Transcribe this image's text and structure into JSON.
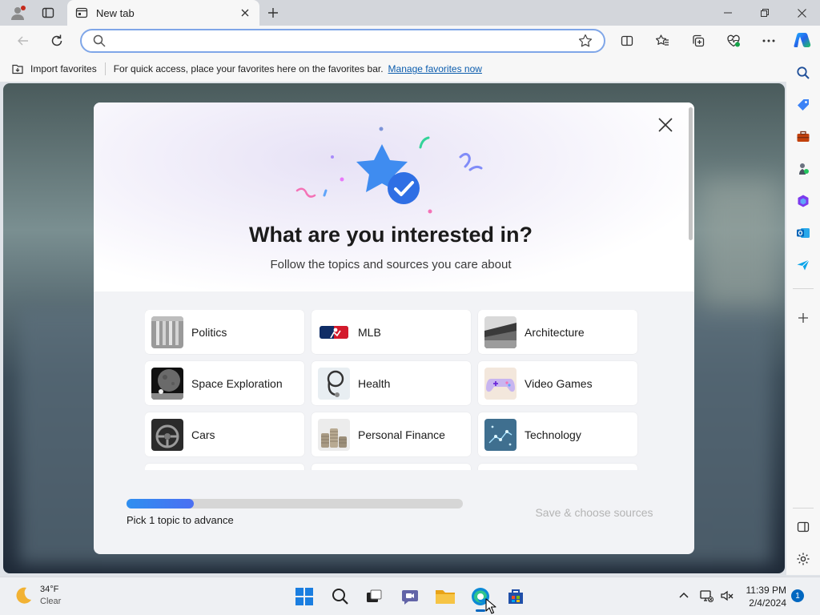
{
  "tab": {
    "title": "New tab"
  },
  "address_bar": {
    "value": "",
    "placeholder": ""
  },
  "favorites_bar": {
    "import_label": "Import favorites",
    "message": "For quick access, place your favorites here on the favorites bar.",
    "manage_link": "Manage favorites now"
  },
  "modal": {
    "title": "What are you interested in?",
    "subtitle": "Follow the topics and sources you care about",
    "topics": [
      {
        "label": "Politics",
        "thumb": "columns-icon"
      },
      {
        "label": "MLB",
        "thumb": "mlb-logo-icon"
      },
      {
        "label": "Architecture",
        "thumb": "building-icon"
      },
      {
        "label": "Space Exploration",
        "thumb": "astronaut-icon"
      },
      {
        "label": "Health",
        "thumb": "stethoscope-icon"
      },
      {
        "label": "Video Games",
        "thumb": "gamepad-icon"
      },
      {
        "label": "Cars",
        "thumb": "steering-wheel-icon"
      },
      {
        "label": "Personal Finance",
        "thumb": "coins-icon"
      },
      {
        "label": "Technology",
        "thumb": "circuit-icon"
      }
    ],
    "progress": {
      "fraction": 0.2,
      "label": "Pick 1 topic to advance"
    },
    "save_label": "Save & choose sources"
  },
  "taskbar": {
    "weather": {
      "temp": "34°F",
      "condition": "Clear"
    },
    "clock": {
      "time": "11:39 PM",
      "date": "2/4/2024"
    },
    "notifications": "1"
  },
  "colors": {
    "accent": "#0067c0",
    "link": "#0b5cad",
    "progress": "#2f8ff0"
  }
}
